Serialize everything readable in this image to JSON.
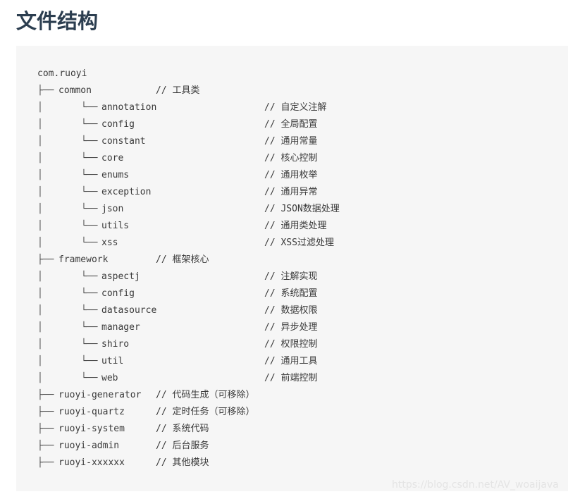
{
  "page": {
    "title": "文件结构"
  },
  "tree": {
    "root": "com.ruoyi",
    "glyphs": {
      "branch": "├──",
      "last": "└──",
      "pipe": "│"
    },
    "lines": [
      {
        "kind": "l1",
        "name": "common",
        "comment": "// 工具类"
      },
      {
        "kind": "l2",
        "name": "annotation",
        "comment": "// 自定义注解"
      },
      {
        "kind": "l2",
        "name": "config",
        "comment": "// 全局配置"
      },
      {
        "kind": "l2",
        "name": "constant",
        "comment": "// 通用常量"
      },
      {
        "kind": "l2",
        "name": "core",
        "comment": "// 核心控制"
      },
      {
        "kind": "l2",
        "name": "enums",
        "comment": "// 通用枚举"
      },
      {
        "kind": "l2",
        "name": "exception",
        "comment": "// 通用异常"
      },
      {
        "kind": "l2",
        "name": "json",
        "comment": "// JSON数据处理"
      },
      {
        "kind": "l2",
        "name": "utils",
        "comment": "// 通用类处理"
      },
      {
        "kind": "l2",
        "name": "xss",
        "comment": "// XSS过滤处理"
      },
      {
        "kind": "l1",
        "name": "framework",
        "comment": "// 框架核心"
      },
      {
        "kind": "l2",
        "name": "aspectj",
        "comment": "// 注解实现"
      },
      {
        "kind": "l2",
        "name": "config",
        "comment": "// 系统配置"
      },
      {
        "kind": "l2",
        "name": "datasource",
        "comment": "// 数据权限"
      },
      {
        "kind": "l2",
        "name": "manager",
        "comment": "// 异步处理"
      },
      {
        "kind": "l2",
        "name": "shiro",
        "comment": "// 权限控制"
      },
      {
        "kind": "l2",
        "name": "util",
        "comment": "// 通用工具"
      },
      {
        "kind": "l2",
        "name": "web",
        "comment": "// 前端控制"
      },
      {
        "kind": "l1",
        "name": "ruoyi-generator",
        "comment": "// 代码生成（可移除）"
      },
      {
        "kind": "l1",
        "name": "ruoyi-quartz",
        "comment": "// 定时任务（可移除）"
      },
      {
        "kind": "l1",
        "name": "ruoyi-system",
        "comment": "// 系统代码"
      },
      {
        "kind": "l1",
        "name": "ruoyi-admin",
        "comment": "// 后台服务"
      },
      {
        "kind": "l1",
        "name": "ruoyi-xxxxxx",
        "comment": "// 其他模块"
      }
    ]
  },
  "watermark": {
    "text": "https://blog.csdn.net/AV_woaijava"
  }
}
